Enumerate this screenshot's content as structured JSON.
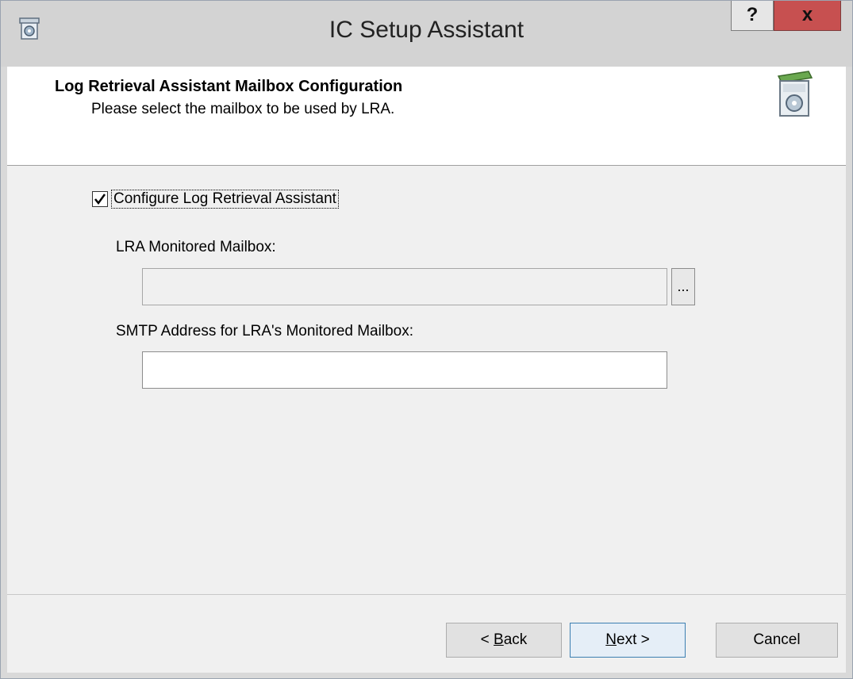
{
  "window": {
    "title": "IC Setup Assistant",
    "help_label": "?",
    "close_label": "x"
  },
  "header": {
    "title": "Log Retrieval Assistant Mailbox Configuration",
    "subtitle": "Please select the mailbox to be used by LRA."
  },
  "form": {
    "configure_checkbox": {
      "label": "Configure Log Retrieval Assistant",
      "checked": true
    },
    "monitored_mailbox": {
      "label": "LRA Monitored Mailbox:",
      "value": "",
      "browse_label": "..."
    },
    "smtp_address": {
      "label": "SMTP Address for LRA's Monitored Mailbox:",
      "value": ""
    }
  },
  "footer": {
    "back_prefix": "< ",
    "back_accel": "B",
    "back_rest": "ack",
    "next_accel": "N",
    "next_rest": "ext >",
    "cancel_label": "Cancel"
  },
  "icons": {
    "app": "setup-package-icon",
    "header": "setup-box-icon",
    "checkbox": "checkmark-icon"
  },
  "colors": {
    "close_button": "#c75050",
    "titlebar": "#d3d3d3",
    "content_background": "#f0f0f0"
  }
}
